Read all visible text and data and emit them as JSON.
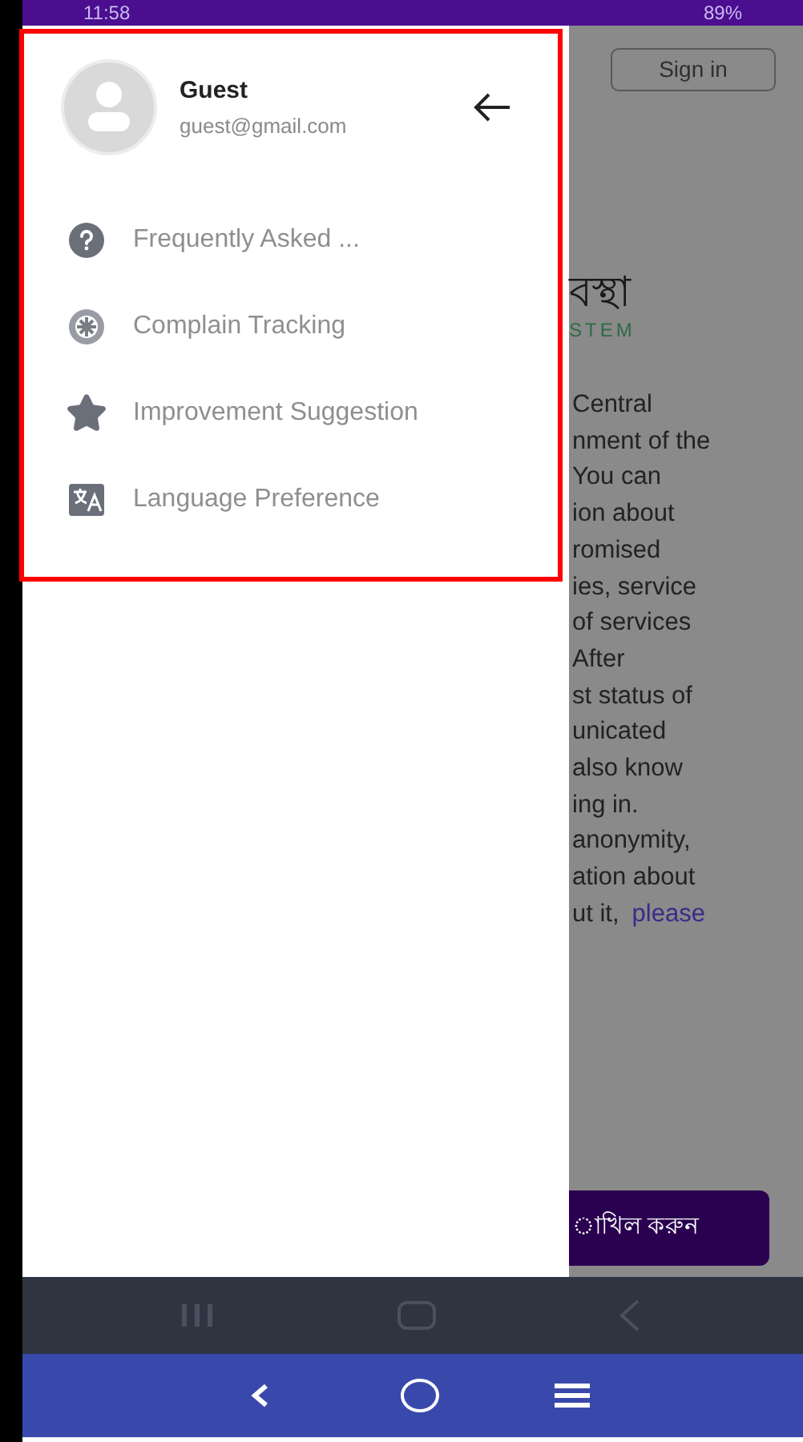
{
  "status_bar": {
    "time": "11:58",
    "battery": "89%"
  },
  "drawer": {
    "user": {
      "name": "Guest",
      "email": "guest@gmail.com"
    },
    "items": [
      {
        "label": "Frequently Asked ..."
      },
      {
        "label": "Complain Tracking"
      },
      {
        "label": "Improvement Suggestion"
      },
      {
        "label": "Language Preference"
      }
    ]
  },
  "background": {
    "sign_in": "Sign in",
    "title": "বস্থা",
    "subtitle": "STEM",
    "lines": [
      "Central",
      "nment of the",
      "You can",
      "ion about",
      "romised",
      "ies, service",
      "of services",
      "After",
      "st status of",
      "unicated",
      "also know",
      "ing in.",
      "anonymity,",
      "ation about"
    ],
    "last_line": {
      "text": "ut it,",
      "link": "please"
    },
    "submit": "াখিল করুন"
  }
}
